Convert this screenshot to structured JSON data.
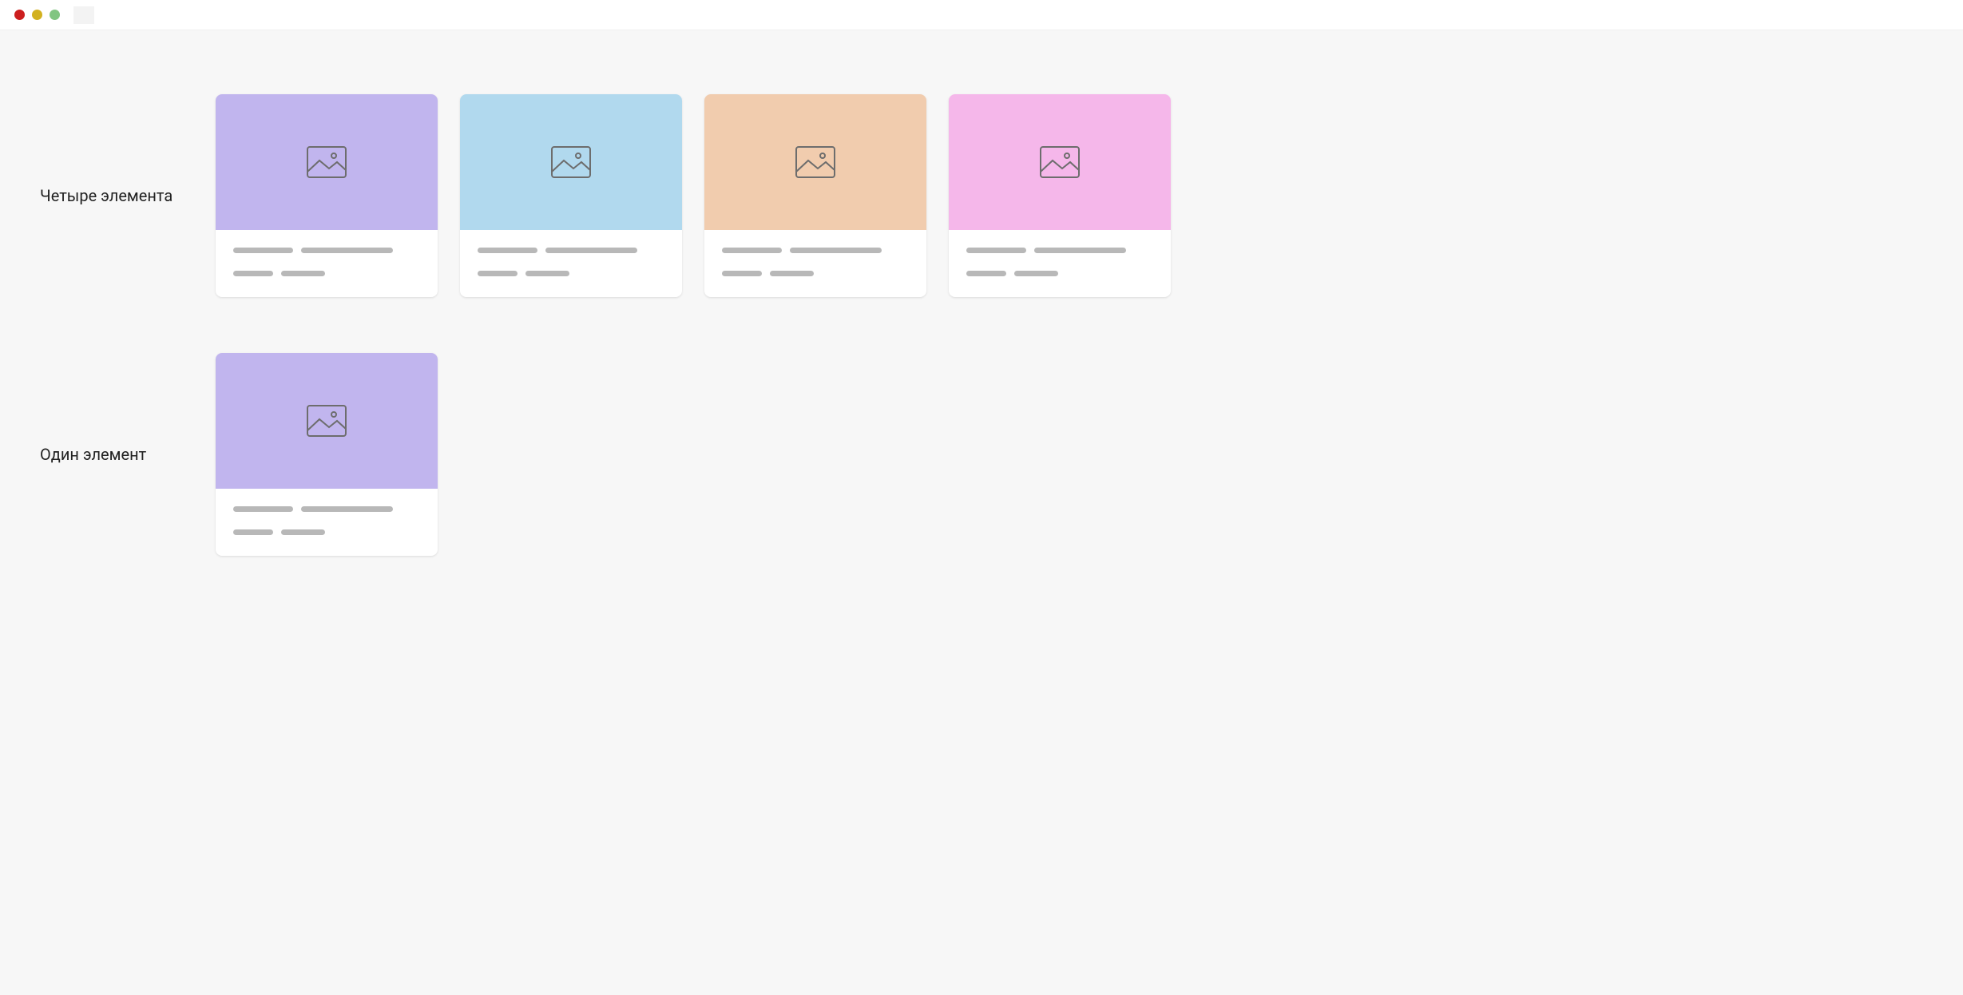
{
  "rows": [
    {
      "label": "Четыре элемента",
      "cards": [
        {
          "color": "#c1b5ee",
          "iconStroke": "#6d6d6d"
        },
        {
          "color": "#b1d9ee",
          "iconStroke": "#6d6d6d"
        },
        {
          "color": "#f1ccae",
          "iconStroke": "#6d6d6d"
        },
        {
          "color": "#f5b7ea",
          "iconStroke": "#6d6d6d"
        }
      ]
    },
    {
      "label": "Один элемент",
      "cards": [
        {
          "color": "#c1b5ee",
          "iconStroke": "#6d6d6d"
        }
      ]
    }
  ]
}
